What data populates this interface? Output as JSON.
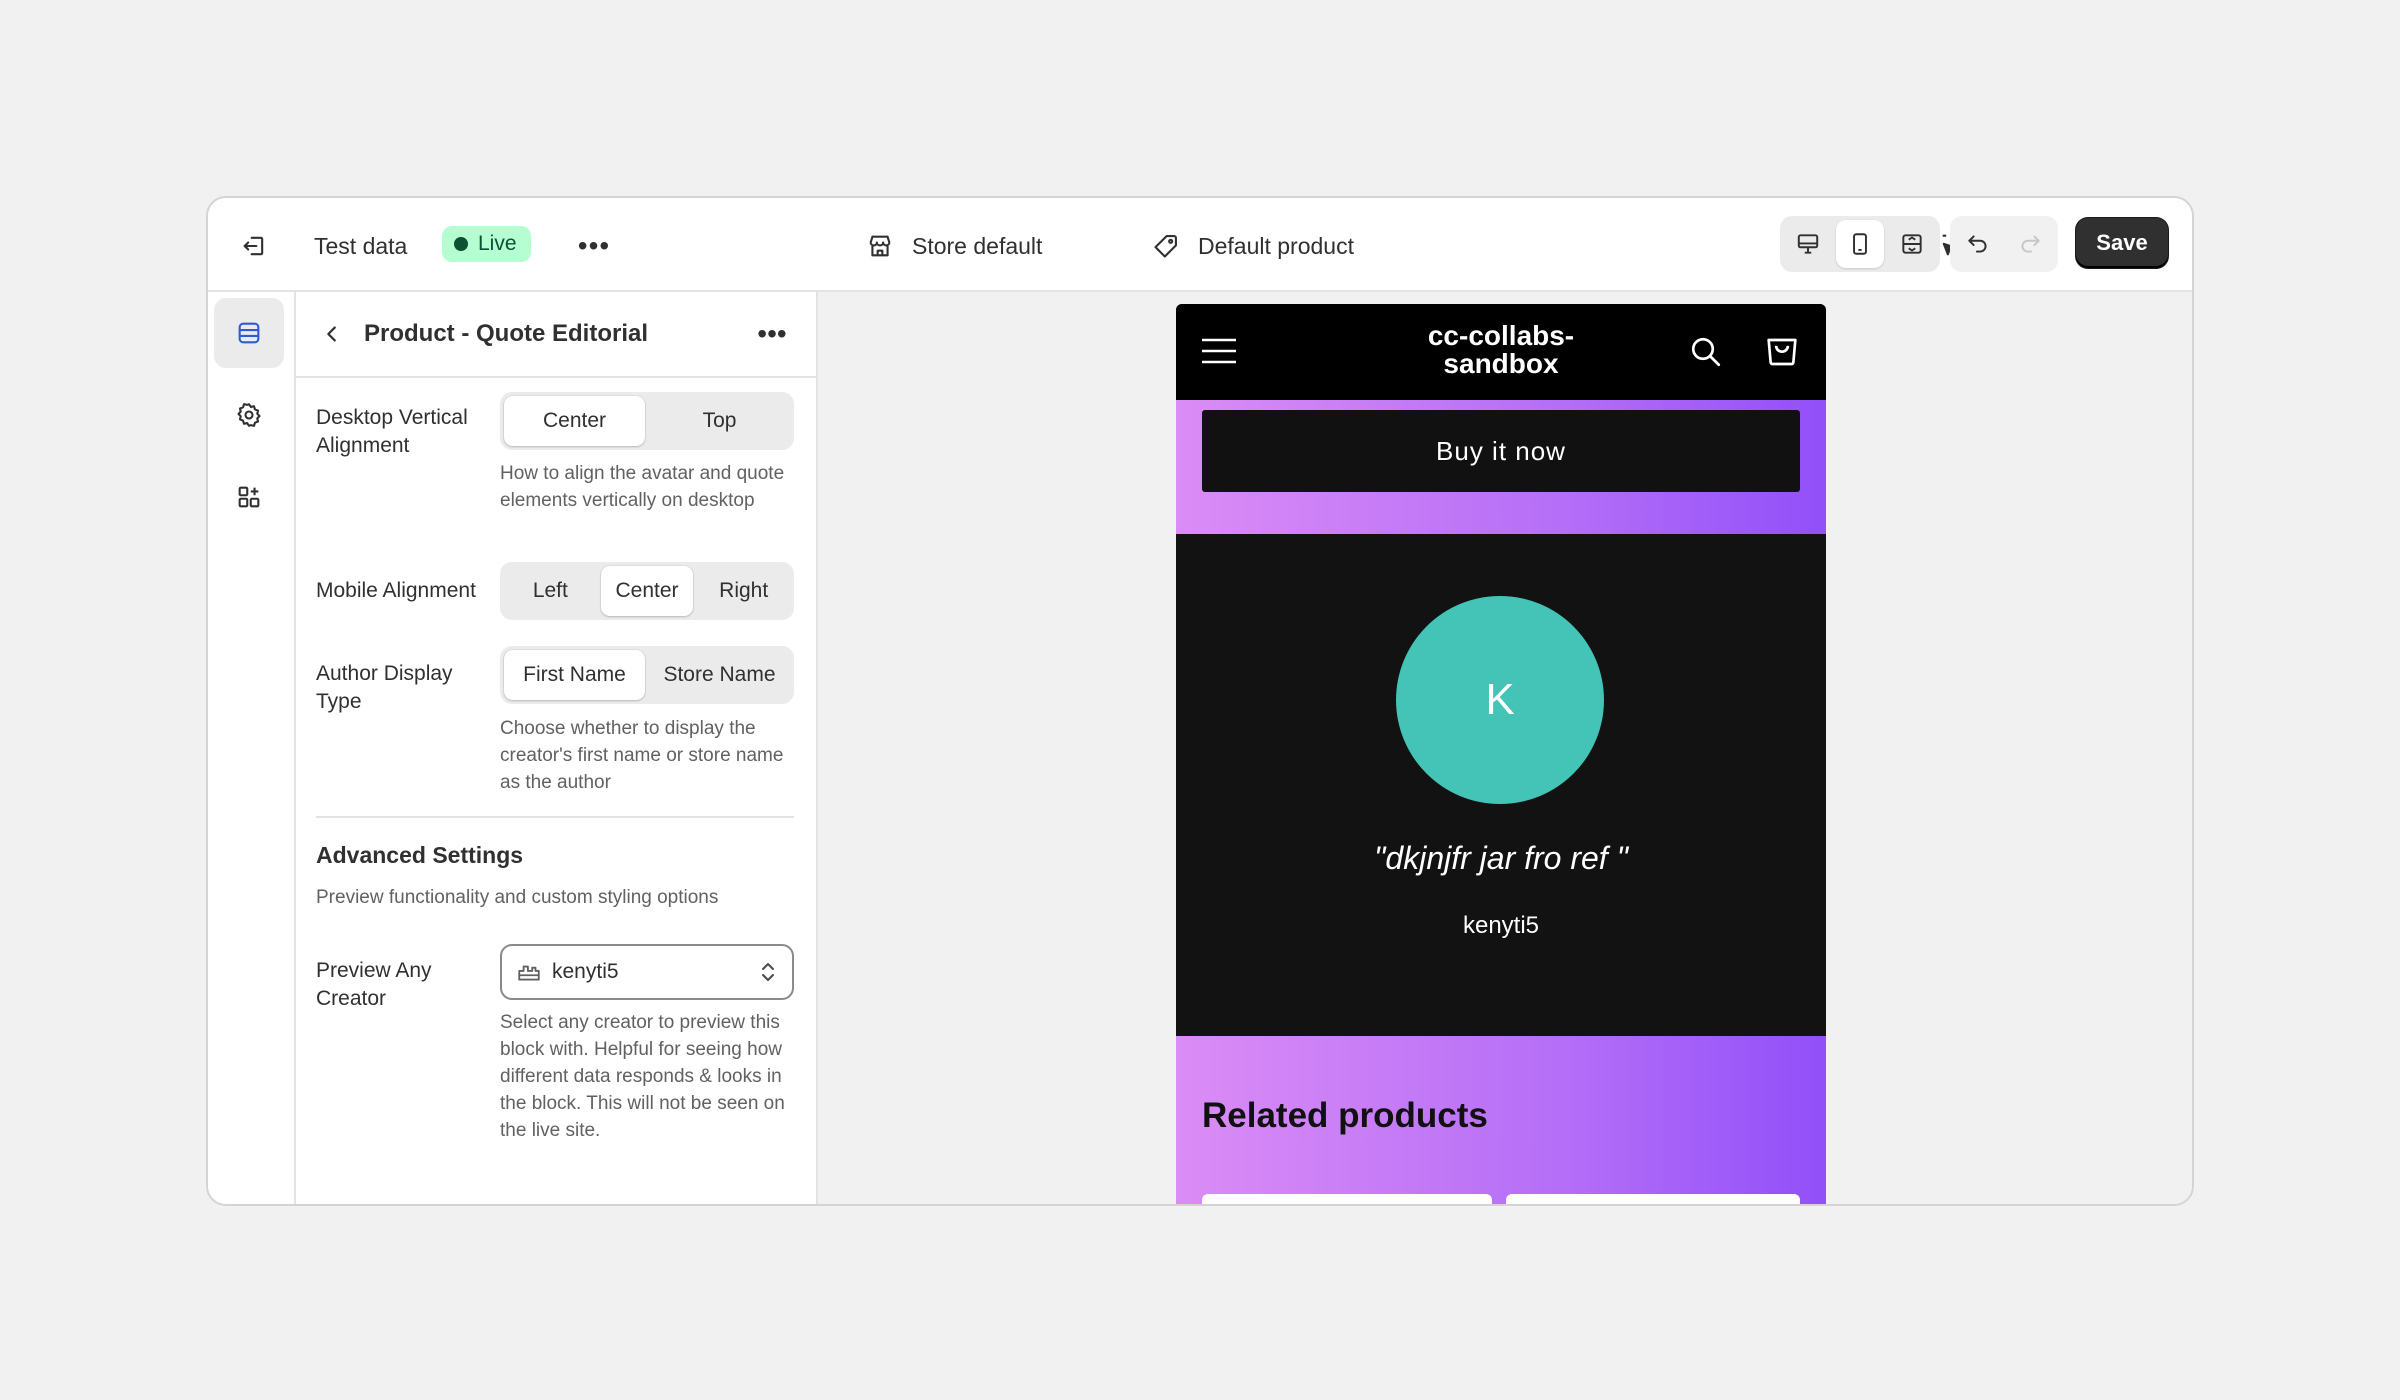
{
  "topbar": {
    "exit_icon": "exit-icon",
    "title": "Test data",
    "status": "Live",
    "more": "•••",
    "store": "Store default",
    "product": "Default product",
    "save_label": "Save"
  },
  "panel": {
    "title": "Product - Quote Editorial",
    "more": "•••",
    "fields": {
      "desktop_align": {
        "label": "Desktop Vertical Alignment",
        "options": [
          "Center",
          "Top"
        ],
        "selected": "Center",
        "help": "How to align the avatar and quote elements vertically on desktop"
      },
      "mobile_align": {
        "label": "Mobile Alignment",
        "options": [
          "Left",
          "Center",
          "Right"
        ],
        "selected": "Center"
      },
      "author_type": {
        "label": "Author Display Type",
        "options": [
          "First Name",
          "Store Name"
        ],
        "selected": "First Name",
        "help": "Choose whether to display the creator's first name or store name as the author"
      }
    },
    "advanced": {
      "title": "Advanced Settings",
      "subtitle": "Preview functionality and custom styling options",
      "preview_creator": {
        "label": "Preview Any Creator",
        "value": "kenyti5",
        "help": "Select any creator to preview this block with. Helpful for seeing how different data responds & looks in the block. This will not be seen on the live site."
      }
    }
  },
  "preview": {
    "brand": "cc-collabs-sandbox",
    "brand_line1": "cc-collabs-",
    "brand_line2": "sandbox",
    "buy_label": "Buy it now",
    "avatar_initial": "K",
    "quote": "\"dkjnjfr jar fro ref \"",
    "author": "kenyti5",
    "related_title": "Related products"
  },
  "colors": {
    "live_bg": "#b4fed2",
    "avatar": "#43c4b7",
    "gradient_start": "#db8cf5",
    "gradient_end": "#9150f8"
  }
}
